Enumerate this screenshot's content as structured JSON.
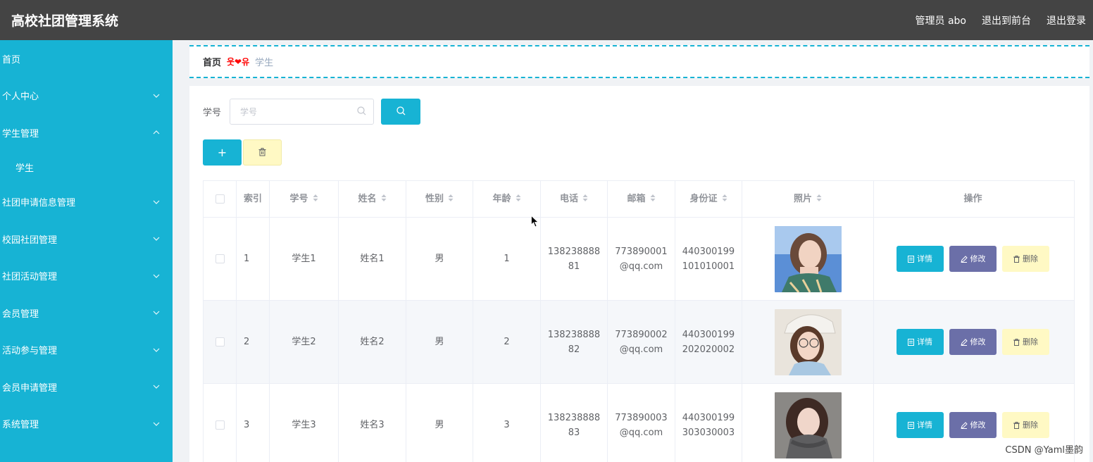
{
  "header": {
    "title": "高校社团管理系统",
    "links": [
      "管理员 abo",
      "退出到前台",
      "退出登录"
    ]
  },
  "sidebar": {
    "items": [
      {
        "label": "首页",
        "chevron": ""
      },
      {
        "label": "个人中心",
        "chevron": "down"
      },
      {
        "label": "学生管理",
        "chevron": "up"
      },
      {
        "label": "学生",
        "chevron": "",
        "sub": true
      },
      {
        "label": "社团申请信息管理",
        "chevron": "down"
      },
      {
        "label": "校园社团管理",
        "chevron": "down"
      },
      {
        "label": "社团活动管理",
        "chevron": "down"
      },
      {
        "label": "会员管理",
        "chevron": "down"
      },
      {
        "label": "活动参与管理",
        "chevron": "down"
      },
      {
        "label": "会员申请管理",
        "chevron": "down"
      },
      {
        "label": "系统管理",
        "chevron": "down"
      }
    ]
  },
  "breadcrumb": {
    "home": "首页",
    "separator": "웃❤유",
    "current": "学生"
  },
  "search": {
    "label": "学号",
    "placeholder": "学号"
  },
  "table": {
    "headers": {
      "index": "索引",
      "sno": "学号",
      "name": "姓名",
      "sex": "性别",
      "age": "年龄",
      "phone": "电话",
      "mail": "邮箱",
      "idcard": "身份证",
      "photo": "照片",
      "ops": "操作"
    },
    "rows": [
      {
        "index": "1",
        "sno": "学生1",
        "name": "姓名1",
        "sex": "男",
        "age": "1",
        "phone1": "138238888",
        "phone2": "81",
        "mail1": "773890001",
        "mail2": "@qq.com",
        "id1": "440300199",
        "id2": "101010001"
      },
      {
        "index": "2",
        "sno": "学生2",
        "name": "姓名2",
        "sex": "男",
        "age": "2",
        "phone1": "138238888",
        "phone2": "82",
        "mail1": "773890002",
        "mail2": "@qq.com",
        "id1": "440300199",
        "id2": "202020002"
      },
      {
        "index": "3",
        "sno": "学生3",
        "name": "姓名3",
        "sex": "男",
        "age": "3",
        "phone1": "138238888",
        "phone2": "83",
        "mail1": "773890003",
        "mail2": "@qq.com",
        "id1": "440300199",
        "id2": "303030003"
      }
    ],
    "op_labels": {
      "detail": "详情",
      "edit": "修改",
      "delete": "删除"
    }
  },
  "watermark": "CSDN @Yaml墨韵",
  "colors": {
    "header_bg": "#444444",
    "sidebar_bg": "#17b3d4",
    "primary": "#17b3d4",
    "edit": "#6b6fa8",
    "danger_bg": "#fff9c4"
  }
}
